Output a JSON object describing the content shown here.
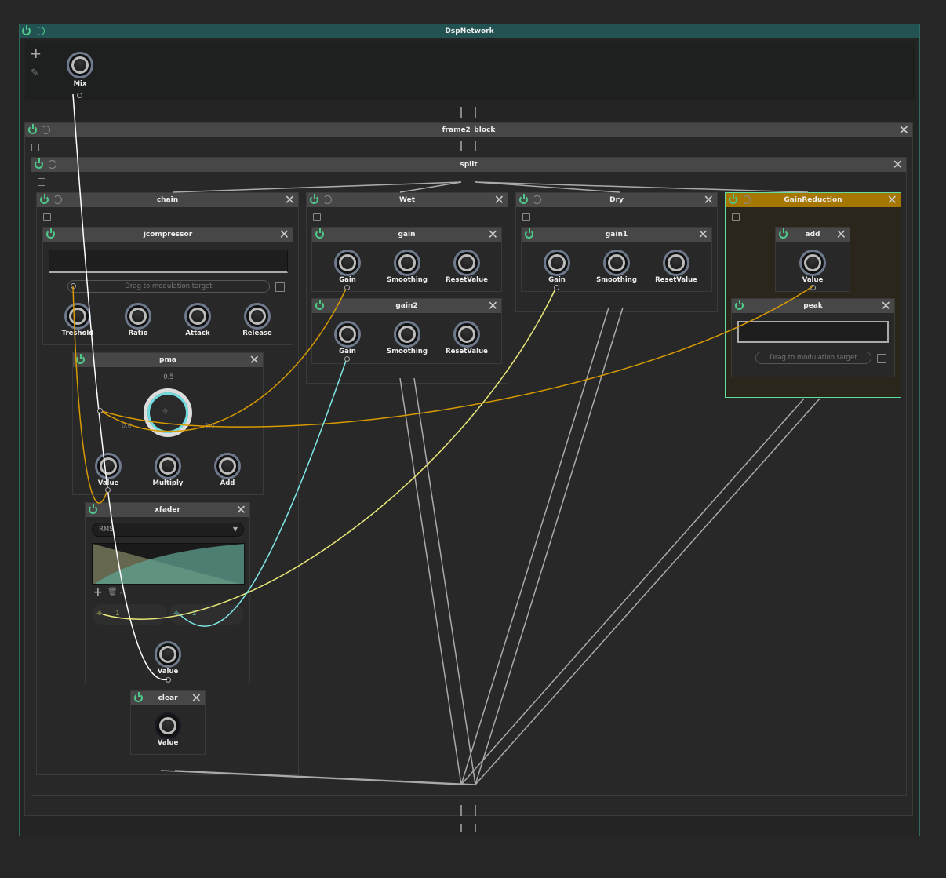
{
  "network": {
    "title": "DspNetwork",
    "parameters": [
      {
        "label": "Mix"
      }
    ],
    "add_icon": "plus-icon",
    "edit_icon": "pencil-icon",
    "header_color": "#225252"
  },
  "nodes": [
    {
      "title": "frame2_block"
    },
    {
      "title": "split"
    },
    {
      "title": "chain"
    },
    {
      "title": "jcompressor",
      "knobs": [
        "Treshold",
        "Ratio",
        "Attack",
        "Release"
      ],
      "mod_label": "Drag to modulation target"
    },
    {
      "title": "pma",
      "knobs": [
        "Value",
        "Multiply",
        "Add"
      ],
      "big_knob": {
        "top": "0.5",
        "min": "0.0",
        "max": "1.0"
      }
    },
    {
      "title": "xfader",
      "knobs": [
        "Value"
      ],
      "mode": "RMS",
      "outputs": [
        "1",
        "2"
      ]
    },
    {
      "title": "clear",
      "knobs": [
        "Value"
      ]
    },
    {
      "title": "Wet"
    },
    {
      "title": "gain",
      "knobs": [
        "Gain",
        "Smoothing",
        "ResetValue"
      ]
    },
    {
      "title": "gain2",
      "knobs": [
        "Gain",
        "Smoothing",
        "ResetValue"
      ]
    },
    {
      "title": "Dry"
    },
    {
      "title": "gain1",
      "knobs": [
        "Gain",
        "Smoothing",
        "ResetValue"
      ]
    },
    {
      "title": "GainReduction",
      "header_color": "#a67700",
      "border_color": "#5fe0a0"
    },
    {
      "title": "add",
      "knobs": [
        "Value"
      ]
    },
    {
      "title": "peak",
      "mod_label": "Drag to modulation target"
    }
  ],
  "cable_colors": {
    "audio": "#aaaaaa",
    "mix": "#ffffff",
    "pma": "#d79a00",
    "xfader1": "#e8e878",
    "xfader2": "#7fe8e8"
  }
}
